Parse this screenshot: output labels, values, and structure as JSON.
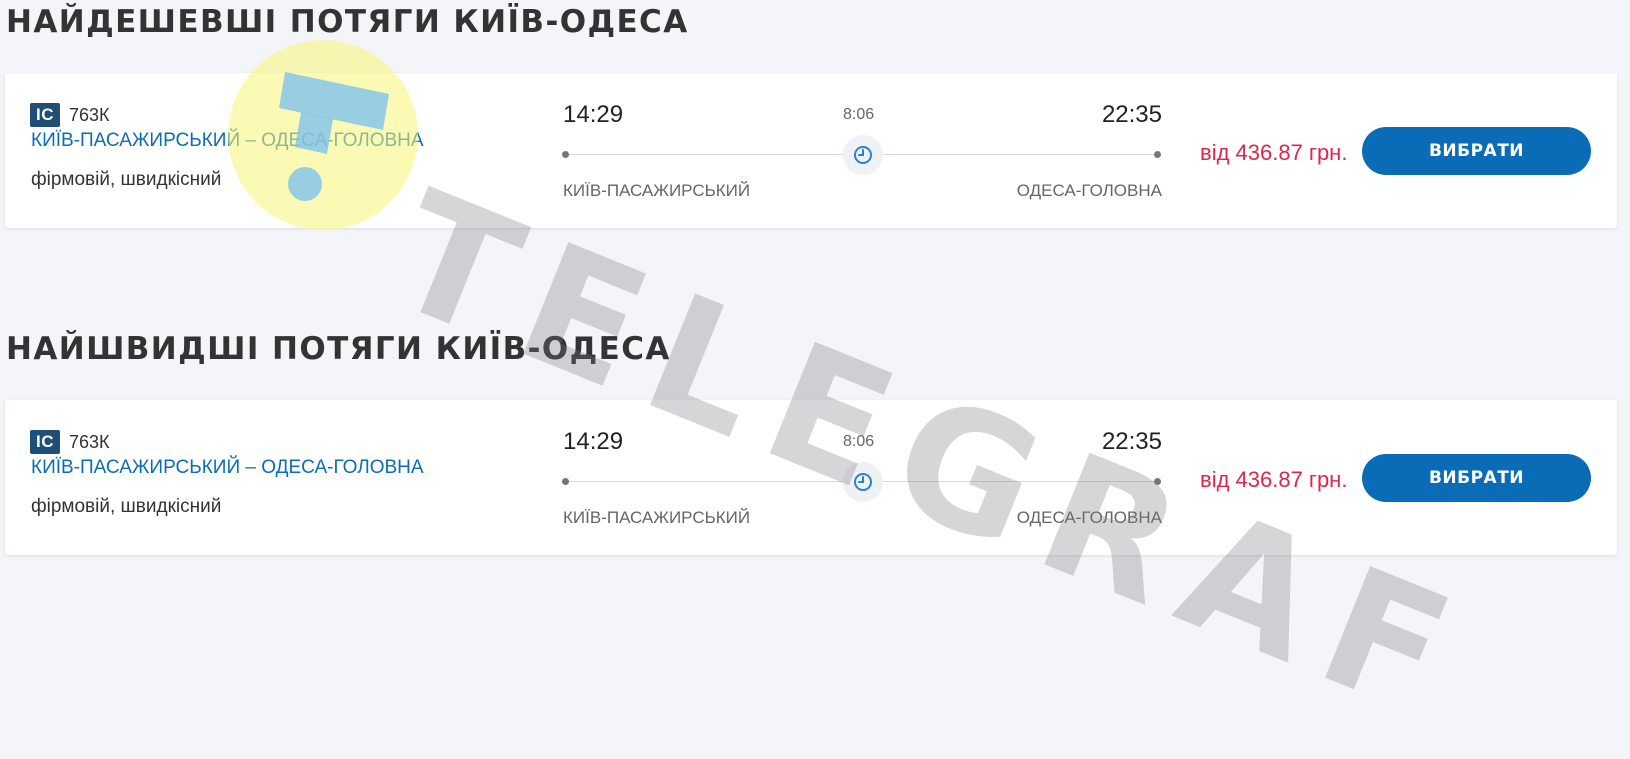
{
  "sections": [
    {
      "title": "НАЙДЕШЕВШІ ПОТЯГИ КИЇВ-ОДЕСА",
      "card": {
        "badge": "IC",
        "train_number": "763К",
        "route": "КИЇВ-ПАСАЖИРСЬКИЙ – ОДЕСА-ГОЛОВНА",
        "train_type": "фірмовій, швидкісний",
        "departure_time": "14:29",
        "duration": "8:06",
        "arrival_time": "22:35",
        "departure_station": "КИЇВ-ПАСАЖИРСЬКИЙ",
        "arrival_station": "ОДЕСА-ГОЛОВНА",
        "price": "від 436.87 грн.",
        "button_label": "ВИБРАТИ"
      }
    },
    {
      "title": "НАЙШВИДШІ ПОТЯГИ КИЇВ-ОДЕСА",
      "card": {
        "badge": "IC",
        "train_number": "763К",
        "route": "КИЇВ-ПАСАЖИРСЬКИЙ – ОДЕСА-ГОЛОВНА",
        "train_type": "фірмовій, швидкісний",
        "departure_time": "14:29",
        "duration": "8:06",
        "arrival_time": "22:35",
        "departure_station": "КИЇВ-ПАСАЖИРСЬКИЙ",
        "arrival_station": "ОДЕСА-ГОЛОВНА",
        "price": "від 436.87 грн.",
        "button_label": "ВИБРАТИ"
      }
    }
  ],
  "watermark": {
    "text": "TELEGRAF"
  },
  "colors": {
    "accent_blue": "#0a6cb6",
    "price_red": "#e0254b",
    "badge_blue": "#1f4e79",
    "background": "#f4f5f9"
  },
  "icons": {
    "clock": "clock-icon",
    "watermark_logo": "telegraf-logo-icon"
  }
}
